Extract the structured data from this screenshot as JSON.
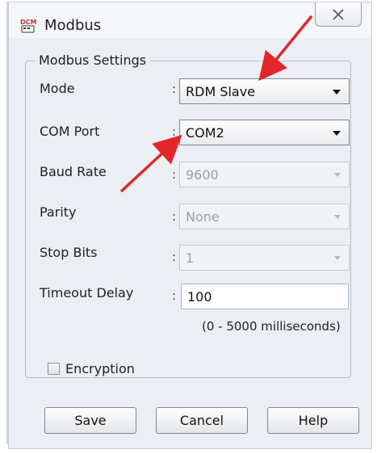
{
  "window": {
    "title": "Modbus",
    "icon": "dcm-app-icon",
    "close_icon": "close-icon"
  },
  "group": {
    "title": "Modbus Settings"
  },
  "fields": {
    "mode": {
      "label": "Mode",
      "colon": ":",
      "value": "RDM Slave",
      "enabled": true
    },
    "com_port": {
      "label": "COM Port",
      "colon": ":",
      "value": "COM2",
      "enabled": true
    },
    "baud_rate": {
      "label": "Baud Rate",
      "colon": ":",
      "value": "9600",
      "enabled": false
    },
    "parity": {
      "label": "Parity",
      "colon": ":",
      "value": "None",
      "enabled": false
    },
    "stop_bits": {
      "label": "Stop Bits",
      "colon": ":",
      "value": "1",
      "enabled": false
    },
    "timeout_delay": {
      "label": "Timeout Delay",
      "colon": ":",
      "value": "100",
      "hint": "(0 - 5000 milliseconds)"
    }
  },
  "encryption": {
    "label": "Encryption",
    "checked": false
  },
  "buttons": {
    "save": "Save",
    "cancel": "Cancel",
    "help": "Help"
  },
  "annotation_color": "#e0262b"
}
